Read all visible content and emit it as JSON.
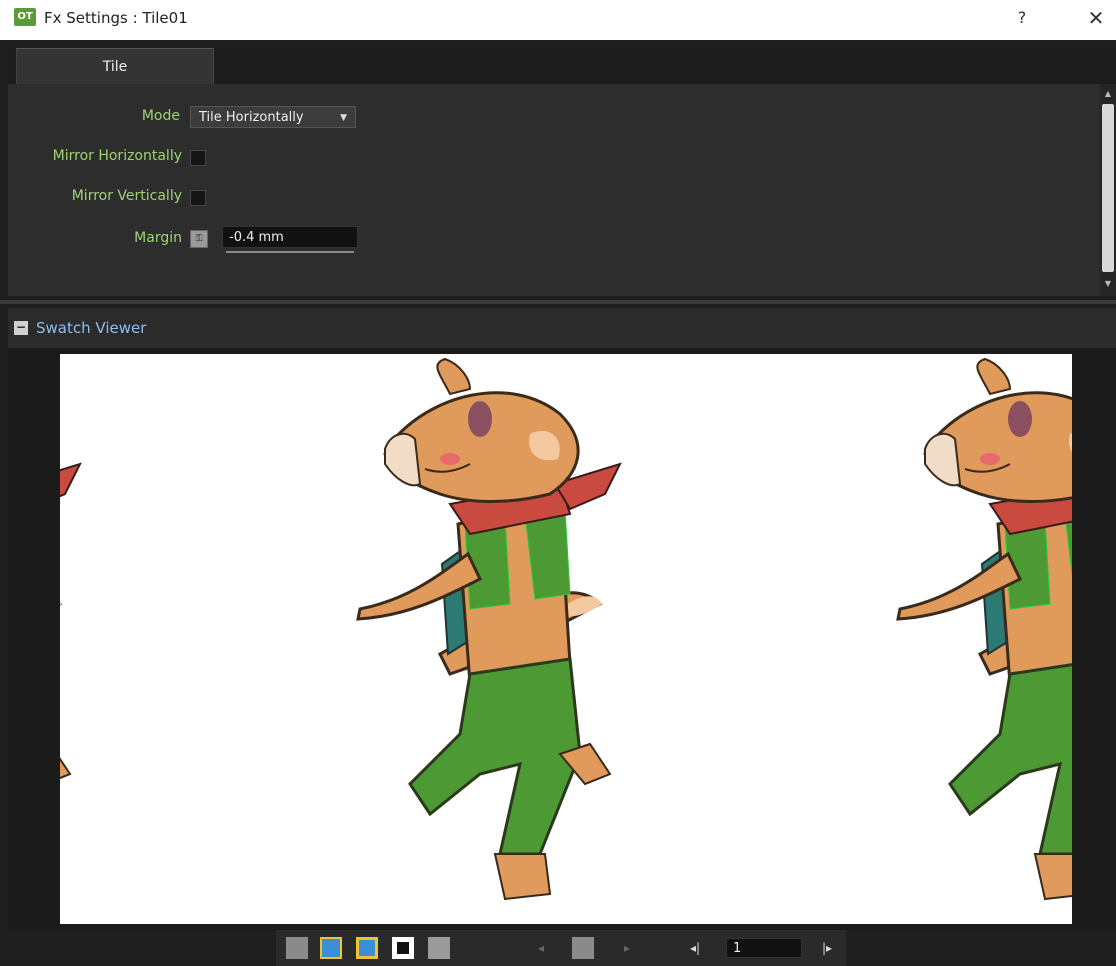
{
  "window": {
    "title": "Fx Settings : Tile01",
    "app_icon_label": "OT",
    "help_label": "?",
    "close_label": "✕"
  },
  "tabs": [
    {
      "label": "Tile",
      "active": true
    }
  ],
  "settings": {
    "mode": {
      "label": "Mode",
      "value": "Tile Horizontally"
    },
    "mirror_horizontally": {
      "label": "Mirror Horizontally",
      "checked": false
    },
    "mirror_vertically": {
      "label": "Mirror Vertically",
      "checked": false
    },
    "margin": {
      "label": "Margin",
      "value": "-0.4 mm"
    }
  },
  "swatch_viewer": {
    "title": "Swatch Viewer",
    "collapse_label": "−"
  },
  "toolbar": {
    "frame_value": "1",
    "prev_frame_label": "◂|",
    "next_frame_label": "|▸"
  },
  "colors": {
    "label_green": "#9fd56f",
    "swatch_title_blue": "#8ebef0",
    "active_toolbar_blue": "#3b8fd6",
    "fox_fur": "#e09a5c",
    "fox_clothes": "#4d9a35",
    "scarf_red": "#c94a3e"
  }
}
